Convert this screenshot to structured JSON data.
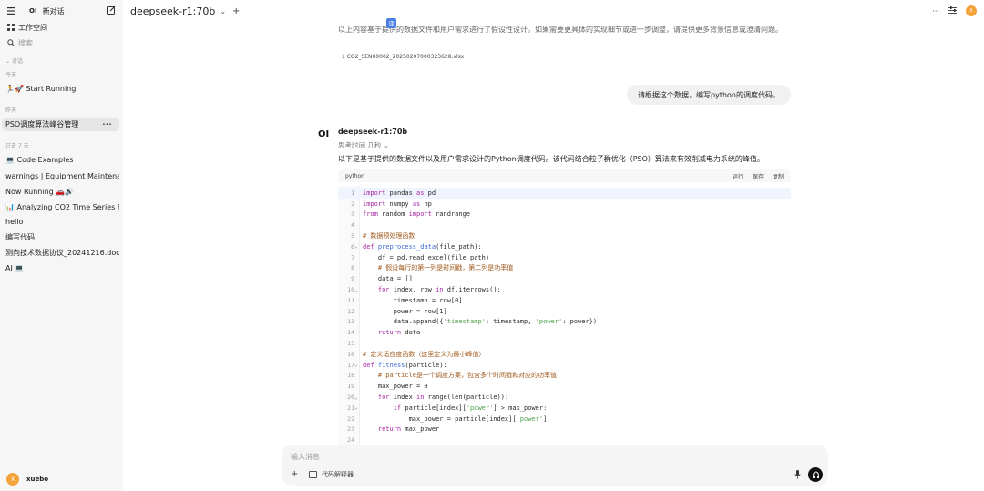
{
  "sidebar": {
    "brand": "OI",
    "new_chat": "新对话",
    "workspace": "工作空间",
    "search_placeholder": "搜索",
    "sections": {
      "chats": "对话",
      "today": "今天",
      "yesterday": "昨天",
      "last7": "过去 7 天"
    },
    "today_items": [
      "🏃🚀 Start Running"
    ],
    "yesterday_items": [
      "PSO调度算法峰谷管理"
    ],
    "last7_items": [
      "💻 Code Examples",
      "warnings | Equipment Maintenance",
      "Now Running 🚗🔊",
      "📊 Analyzing CO2 Time Series Fe",
      "hello",
      "编写代码",
      "测向技术数据协议_20241216.docx总",
      "AI 💻"
    ],
    "active_more": "···",
    "user_name": "xuebo",
    "user_initial": "X"
  },
  "header": {
    "model": "deepseek-r1:70b",
    "more": "···",
    "avatar_initial": "X"
  },
  "chat": {
    "prev_text": "以上内容基于提供的数据文件和用户需求进行了假设性设计。如果需要更具体的实现细节或进一步调整，请提供更多背景信息或澄清问题。",
    "file_ref": "1  CO2_SEN00002_20250207000323628.xlsx",
    "user_message": "请根据这个数据，编写python的调度代码。",
    "bot_logo": "OI",
    "bot_name": "deepseek-r1:70b",
    "thinking": "思考时间 几秒",
    "intro": "以下是基于提供的数据文件以及用户需求设计的Python调度代码。该代码结合粒子群优化（PSO）算法来有效削减电力系统的峰值。",
    "code": {
      "language": "python",
      "run": "运行",
      "save": "保存",
      "copy": "复制",
      "lines": [
        "import pandas as pd",
        "import numpy as np",
        "from random import randrange",
        "",
        "# 数据预处理函数",
        "def preprocess_data(file_path):",
        "    df = pd.read_excel(file_path)",
        "    # 假设每行的第一列是时间戳，第二列是功率值",
        "    data = []",
        "    for index, row in df.iterrows():",
        "        timestamp = row[0]",
        "        power = row[1]",
        "        data.append({'timestamp': timestamp, 'power': power})",
        "    return data",
        "",
        "# 定义适应度函数（这里定义为最小峰值）",
        "def fitness(particle):",
        "    # particle是一个调度方案，包含多个时间戳和对应的功率值",
        "    max_power = 0",
        "    for index in range(len(particle)):",
        "        if particle[index]['power'] > max_power:",
        "            max_power = particle[index]['power']",
        "    return max_power",
        ""
      ]
    }
  },
  "input": {
    "placeholder": "输入消息",
    "tool_label": "代码解释器"
  }
}
